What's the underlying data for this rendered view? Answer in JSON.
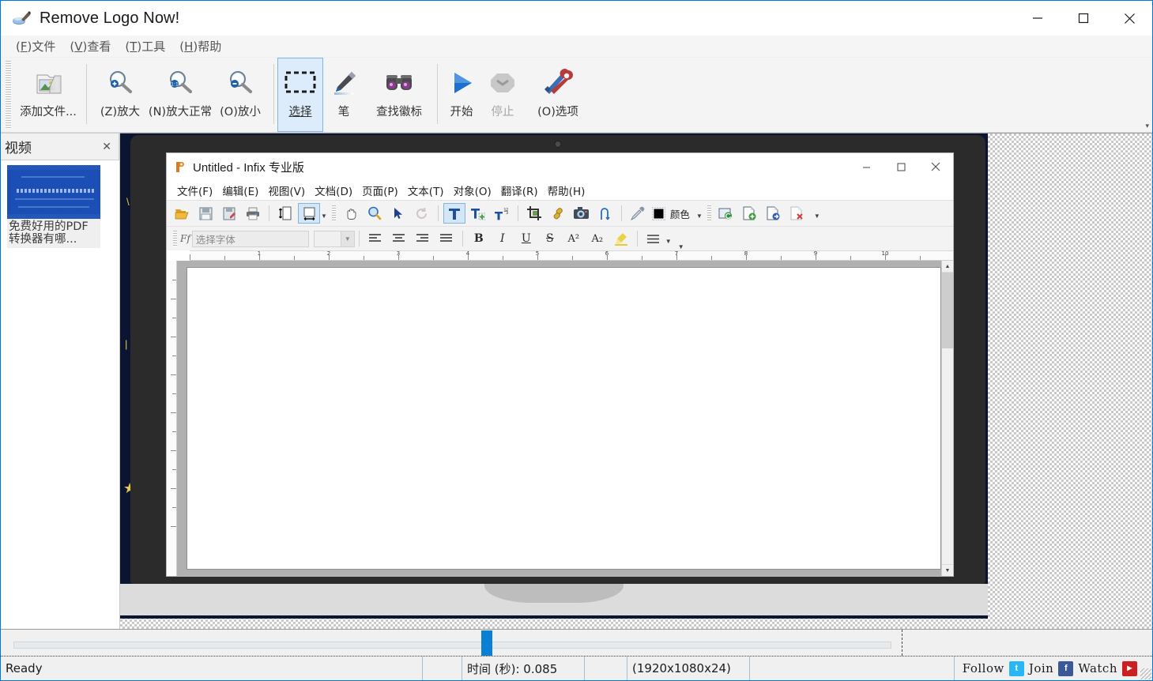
{
  "app": {
    "title": "Remove Logo Now!",
    "icon": "app-logo-icon",
    "window_controls": {
      "minimize": "—",
      "maximize": "□",
      "close": "✕"
    }
  },
  "menubar": [
    {
      "accel": "F",
      "label": "文件",
      "name": "menu-file"
    },
    {
      "accel": "V",
      "label": "查看",
      "name": "menu-view"
    },
    {
      "accel": "T",
      "label": "工具",
      "name": "menu-tools"
    },
    {
      "accel": "H",
      "label": "帮助",
      "name": "menu-help"
    }
  ],
  "toolbar": {
    "items": [
      {
        "name": "add-files-button",
        "label": "添加文件...",
        "icon": "add-files-icon",
        "state": "normal"
      },
      {
        "name": "zoom-in-button",
        "label": "(Z)放大",
        "icon": "zoom-in-icon",
        "state": "normal"
      },
      {
        "name": "zoom-normal-button",
        "label": "(N)放大正常",
        "icon": "zoom-normal-icon",
        "state": "normal"
      },
      {
        "name": "zoom-out-button",
        "label": "(O)放小",
        "icon": "zoom-out-icon",
        "state": "normal"
      },
      {
        "name": "select-tool-button",
        "label": "选择",
        "icon": "marquee-select-icon",
        "state": "selected"
      },
      {
        "name": "pen-tool-button",
        "label": "笔",
        "icon": "pen-icon",
        "state": "normal"
      },
      {
        "name": "find-logo-button",
        "label": "查找徽标",
        "icon": "binoculars-icon",
        "state": "normal"
      },
      {
        "name": "start-button",
        "label": "开始",
        "icon": "play-icon",
        "state": "normal"
      },
      {
        "name": "stop-button",
        "label": "停止",
        "icon": "stop-icon",
        "state": "disabled"
      },
      {
        "name": "options-button",
        "label": "(O)选项",
        "icon": "tools-options-icon",
        "state": "normal"
      }
    ],
    "overflow": "▾"
  },
  "dock": {
    "title": "视频",
    "close": "✕",
    "thumbnail_caption": "免费好用的PDF转换器有哪..."
  },
  "infix": {
    "title": "Untitled - Infix 专业版",
    "icon": "infix-app-icon",
    "window_controls": {
      "minimize": "—",
      "maximize": "□",
      "close": "✕"
    },
    "menu": [
      "文件(F)",
      "编辑(E)",
      "视图(V)",
      "文档(D)",
      "页面(P)",
      "文本(T)",
      "对象(O)",
      "翻译(R)",
      "帮助(H)"
    ],
    "toolbar1": [
      {
        "name": "open-icon",
        "icon": "folder-open-icon"
      },
      {
        "name": "save-icon",
        "icon": "floppy-save-icon"
      },
      {
        "name": "save-as-icon",
        "icon": "save-as-icon"
      },
      {
        "name": "print-icon",
        "icon": "printer-icon"
      },
      {
        "name": "fit-height-icon",
        "icon": "fit-page-height-icon"
      },
      {
        "name": "fit-width-icon",
        "icon": "fit-page-width-icon",
        "state": "selected"
      },
      {
        "name": "pan-tool-icon",
        "icon": "hand-pan-icon"
      },
      {
        "name": "zoom-tool-icon",
        "icon": "magnifier-icon"
      },
      {
        "name": "select-arrow-icon",
        "icon": "arrow-select-icon"
      },
      {
        "name": "rotate-icon",
        "icon": "rotate-refresh-icon"
      },
      {
        "name": "text-tool-icon",
        "icon": "text-T-icon",
        "state": "selected"
      },
      {
        "name": "new-text-icon",
        "icon": "text-add-icon"
      },
      {
        "name": "text-number-icon",
        "icon": "text-numbering-icon"
      },
      {
        "name": "crop-icon",
        "icon": "crop-icon"
      },
      {
        "name": "link-icon",
        "icon": "link-chain-icon"
      },
      {
        "name": "image-icon",
        "icon": "camera-image-icon"
      },
      {
        "name": "path-icon",
        "icon": "path-curve-icon"
      },
      {
        "name": "eyedropper-icon",
        "icon": "eyedropper-icon"
      },
      {
        "name": "color-swatch",
        "icon": "color-swatch-icon"
      },
      {
        "name": "refresh-doc-icon",
        "icon": "refresh-document-icon"
      },
      {
        "name": "page-add-icon",
        "icon": "page-add-icon"
      },
      {
        "name": "page-export-icon",
        "icon": "page-export-icon"
      },
      {
        "name": "page-delete-icon",
        "icon": "page-delete-icon"
      }
    ],
    "color_label": "颜色",
    "font_placeholder": "选择字体",
    "font_size_value": "",
    "format_buttons": [
      {
        "name": "bold-button",
        "label": "B"
      },
      {
        "name": "italic-button",
        "label": "I"
      },
      {
        "name": "underline-button",
        "label": "U"
      },
      {
        "name": "strikethrough-button",
        "label": "S"
      },
      {
        "name": "superscript-button",
        "label": "A²"
      },
      {
        "name": "subscript-button",
        "label": "A₂"
      },
      {
        "name": "highlight-button",
        "label": "highlighter-icon"
      }
    ],
    "ruler_numbers": [
      "1",
      "2",
      "3",
      "4",
      "5",
      "6",
      "7",
      "8",
      "9",
      "10"
    ]
  },
  "timeline": {
    "playhead_position": "608"
  },
  "statusbar": {
    "ready": "Ready",
    "time_label": "时间 (秒): 0.085",
    "resolution": "(1920x1080x24)",
    "social": [
      {
        "label": "Follow",
        "icon": "twitter-icon",
        "glyph": "t"
      },
      {
        "label": "Join",
        "icon": "facebook-icon",
        "glyph": "f"
      },
      {
        "label": "Watch",
        "icon": "youtube-icon",
        "glyph": "▶"
      }
    ]
  },
  "colors": {
    "accent": "#0078d7",
    "selection": "#dcecfa",
    "playhead": "#0b7fd4",
    "video_bg": "#0b1430"
  }
}
